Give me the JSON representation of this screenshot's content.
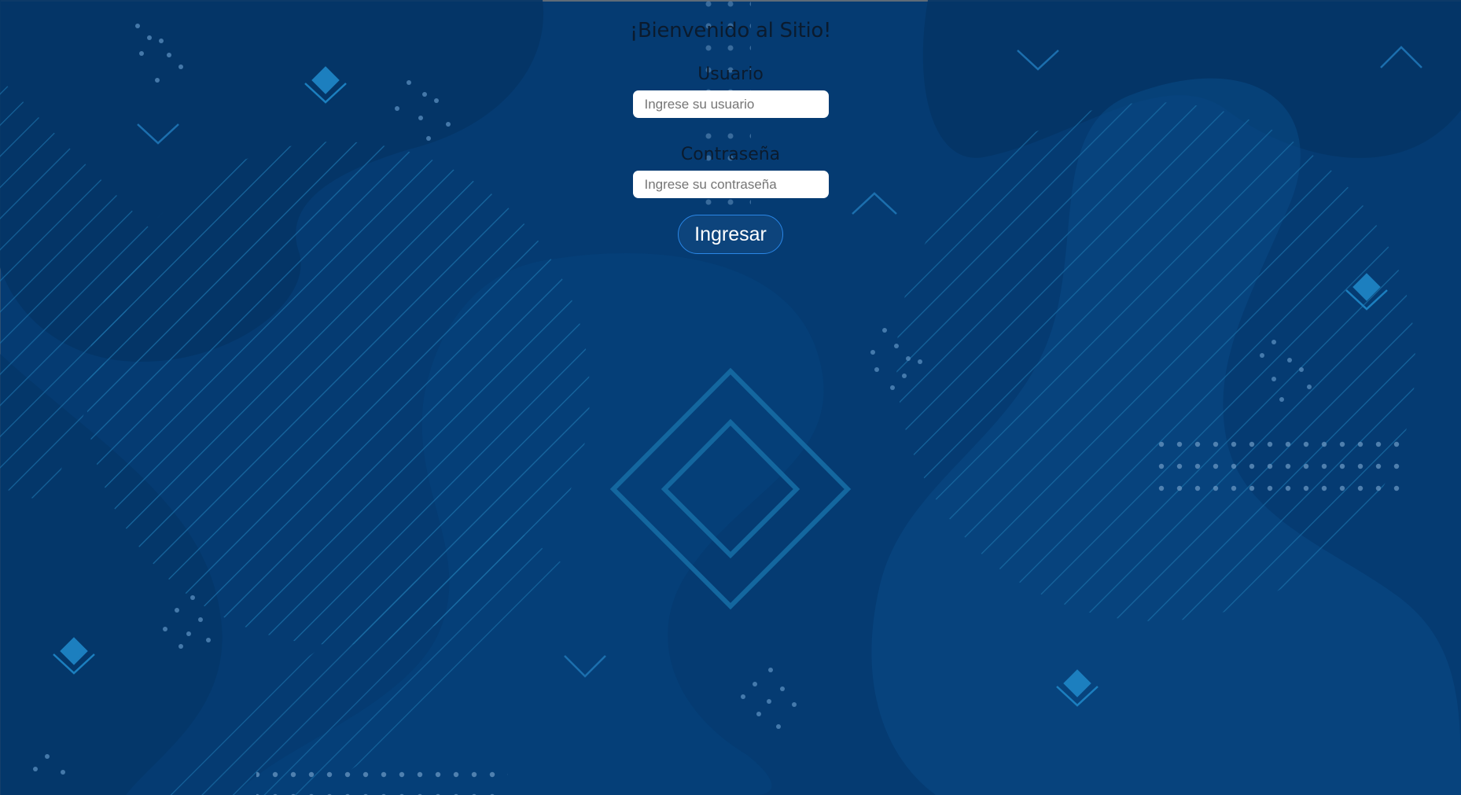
{
  "colors": {
    "background": "#053b72",
    "accent_lines": "#1a6fa8",
    "input_background": "#ffffff",
    "button_border": "#2a86e6"
  },
  "login": {
    "title": "¡Bienvenido al Sitio!",
    "username": {
      "label": "Usuario",
      "placeholder": "Ingrese su usuario",
      "value": ""
    },
    "password": {
      "label": "Contraseña",
      "placeholder": "Ingrese su contraseña",
      "value": ""
    },
    "submit_label": "Ingresar"
  }
}
